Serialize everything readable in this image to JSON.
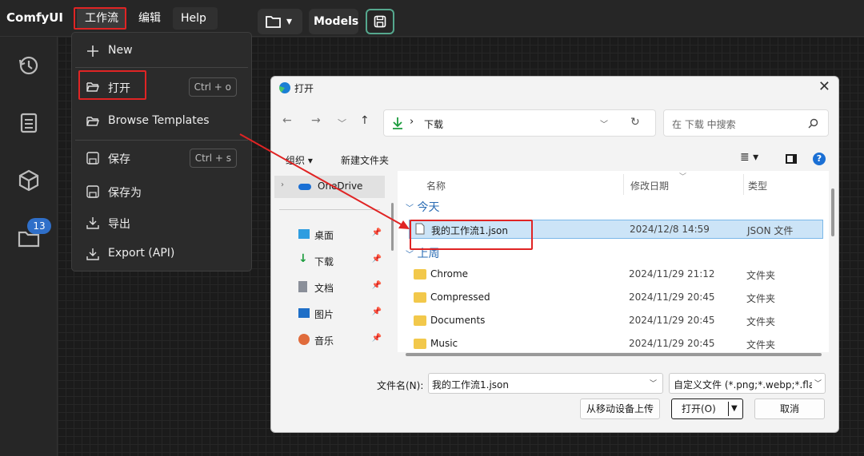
{
  "app": {
    "brand": "ComfyUI"
  },
  "topbar": {
    "menus": [
      "工作流",
      "编辑",
      "Help"
    ],
    "folder_caret": "▾",
    "models_label": "Models"
  },
  "sidebar": {
    "icons": [
      "history-icon",
      "document-icon",
      "cube-icon",
      "folder-icon"
    ],
    "badge": "13"
  },
  "dropdown": {
    "items": [
      {
        "label": "New",
        "icon": "plus-icon",
        "shortcut": ""
      },
      {
        "label": "打开",
        "icon": "folder-open-icon",
        "shortcut": "Ctrl + o"
      },
      {
        "label": "Browse Templates",
        "icon": "folder-open-icon",
        "shortcut": ""
      },
      {
        "label": "保存",
        "icon": "save-icon",
        "shortcut": "Ctrl + s"
      },
      {
        "label": "保存为",
        "icon": "save-icon",
        "shortcut": ""
      },
      {
        "label": "导出",
        "icon": "download-icon",
        "shortcut": ""
      },
      {
        "label": "Export (API)",
        "icon": "download-icon",
        "shortcut": ""
      }
    ]
  },
  "dialog": {
    "title": "打开",
    "path": "下载",
    "path_sep": "›",
    "search_placeholder": "在 下载 中搜索",
    "organize": "组织 ▾",
    "new_folder": "新建文件夹",
    "columns": [
      "名称",
      "修改日期",
      "类型"
    ],
    "nav": [
      {
        "label": "OneDrive",
        "icon": "cloud-icon"
      },
      {
        "label": "桌面",
        "icon": "desktop-icon"
      },
      {
        "label": "下载",
        "icon": "download-icon"
      },
      {
        "label": "文档",
        "icon": "document-icon"
      },
      {
        "label": "图片",
        "icon": "image-icon"
      },
      {
        "label": "音乐",
        "icon": "music-icon"
      }
    ],
    "groups": [
      "今天",
      "上周"
    ],
    "files": [
      {
        "name": "我的工作流1.json",
        "date": "2024/12/8 14:59",
        "type": "JSON 文件",
        "selected": true
      },
      {
        "name": "Chrome",
        "date": "2024/11/29 21:12",
        "type": "文件夹"
      },
      {
        "name": "Compressed",
        "date": "2024/11/29 20:45",
        "type": "文件夹"
      },
      {
        "name": "Documents",
        "date": "2024/11/29 20:45",
        "type": "文件夹"
      },
      {
        "name": "Music",
        "date": "2024/11/29 20:45",
        "type": "文件夹"
      }
    ],
    "filename_label": "文件名(N):",
    "filename_value": "我的工作流1.json",
    "filetype": "自定义文件 (*.png;*.webp;*.fla",
    "upload_button": "从移动设备上传",
    "open_button": "打开(O)",
    "cancel_button": "取消"
  },
  "colors": {
    "accent_red": "#e02424",
    "highlight_blue": "#cce4f7",
    "badge_blue": "#2f6fc9"
  }
}
